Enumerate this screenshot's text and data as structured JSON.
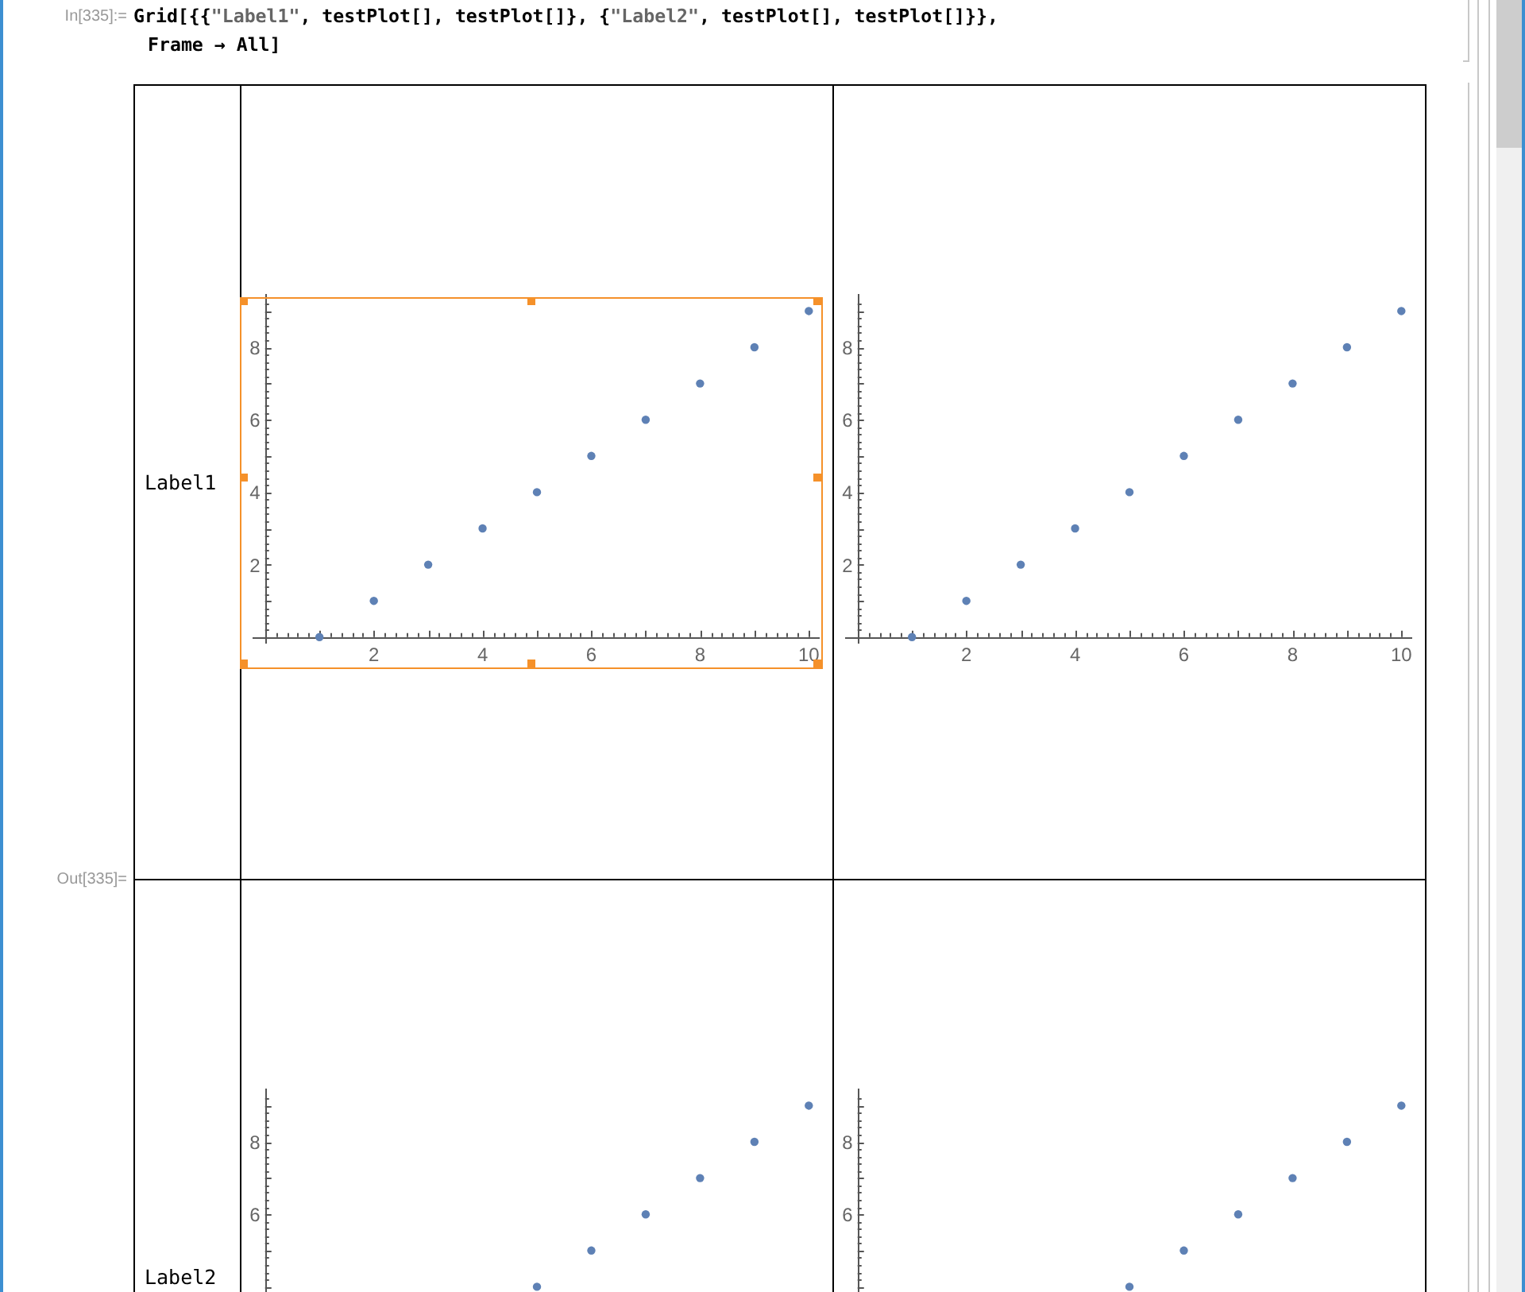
{
  "input_cell": {
    "label": "In[335]:=",
    "lines": [
      [
        {
          "kind": "code",
          "text": "Grid[{{"
        },
        {
          "kind": "string",
          "text": "\"Label1\""
        },
        {
          "kind": "code",
          "text": ", testPlot[], testPlot[]}, {"
        },
        {
          "kind": "string",
          "text": "\"Label2\""
        },
        {
          "kind": "code",
          "text": ", testPlot[], testPlot[]}},"
        }
      ],
      [
        {
          "kind": "code",
          "text": "Frame → All]"
        }
      ]
    ]
  },
  "output_cell": {
    "label": "Out[335]=",
    "grid": {
      "rows": [
        {
          "label": "Label1",
          "plots": [
            {
              "selected": true,
              "chart_data": {
                "type": "scatter",
                "x": [
                  1,
                  2,
                  3,
                  4,
                  5,
                  6,
                  7,
                  8,
                  9,
                  10
                ],
                "series": [
                  {
                    "color": "#5e81b5",
                    "values": [
                      0,
                      1,
                      2,
                      3,
                      4,
                      5,
                      6,
                      7,
                      8,
                      9
                    ]
                  }
                ],
                "xlim": [
                  -0.23,
                  10.2
                ],
                "ylim": [
                  -0.18,
                  9.47
                ],
                "xticks": [
                  2,
                  4,
                  6,
                  8,
                  10
                ],
                "yticks": [
                  2,
                  4,
                  6,
                  8
                ]
              }
            },
            {
              "selected": false,
              "chart_data": {
                "type": "scatter",
                "x": [
                  1,
                  2,
                  3,
                  4,
                  5,
                  6,
                  7,
                  8,
                  9,
                  10
                ],
                "series": [
                  {
                    "color": "#5e81b5",
                    "values": [
                      0,
                      1,
                      2,
                      3,
                      4,
                      5,
                      6,
                      7,
                      8,
                      9
                    ]
                  }
                ],
                "xlim": [
                  -0.23,
                  10.2
                ],
                "ylim": [
                  -0.18,
                  9.47
                ],
                "xticks": [
                  2,
                  4,
                  6,
                  8,
                  10
                ],
                "yticks": [
                  2,
                  4,
                  6,
                  8
                ]
              }
            }
          ]
        },
        {
          "label": "Label2",
          "plots": [
            {
              "selected": false,
              "y_tick_labels": [
                "8",
                "6"
              ]
            },
            {
              "selected": false,
              "y_tick_labels": [
                "8",
                "6"
              ]
            }
          ]
        }
      ]
    }
  }
}
